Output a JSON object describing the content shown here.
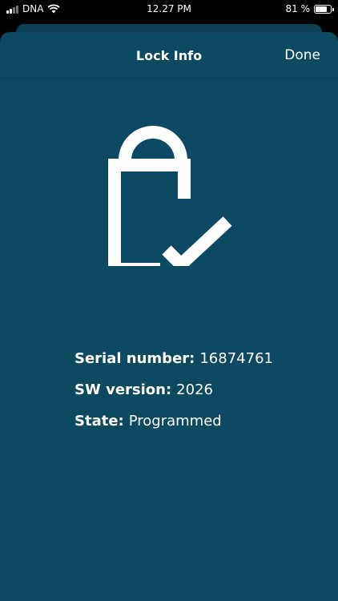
{
  "status_bar": {
    "carrier": "DNA",
    "time": "12.27 PM",
    "battery": "81 %",
    "battery_level": 0.81
  },
  "header": {
    "title": "Lock Info",
    "done_label": "Done"
  },
  "icons": {
    "main": "lock-check-icon"
  },
  "colors": {
    "background": "#0b4a60",
    "foreground": "#ffffff"
  },
  "info": {
    "serial_label": "Serial number:",
    "serial_value": "16874761",
    "sw_label": "SW version:",
    "sw_value": "2026",
    "state_label": "State:",
    "state_value": "Programmed"
  }
}
